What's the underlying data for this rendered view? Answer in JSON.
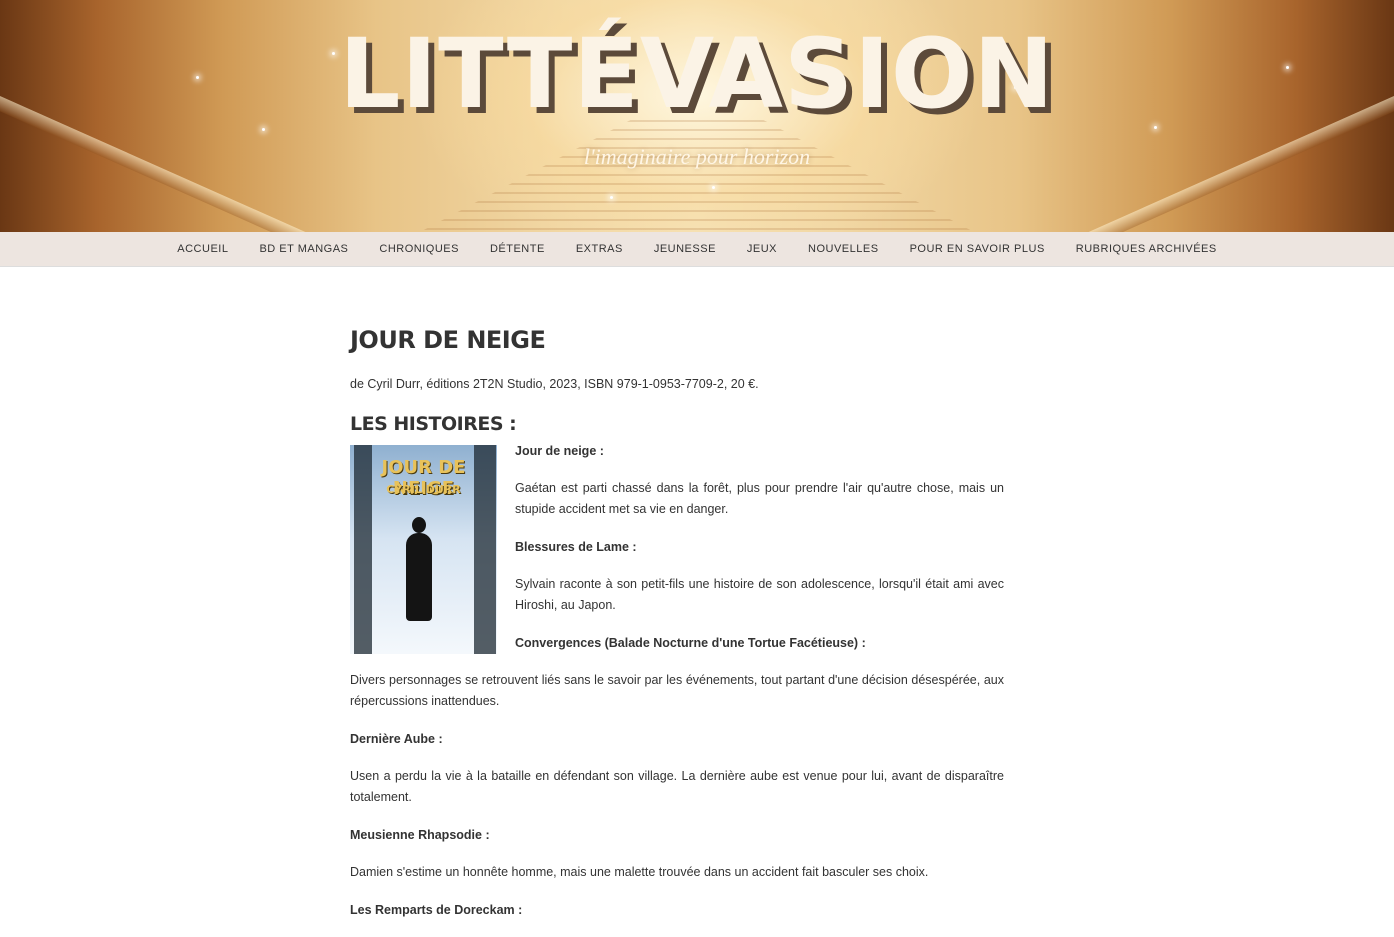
{
  "header": {
    "site_title": "LITTÉVASION",
    "tagline": "l'imaginaire pour horizon"
  },
  "nav": {
    "items": [
      {
        "label": "ACCUEIL"
      },
      {
        "label": "BD ET MANGAS"
      },
      {
        "label": "CHRONIQUES"
      },
      {
        "label": "DÉTENTE"
      },
      {
        "label": "EXTRAS"
      },
      {
        "label": "JEUNESSE"
      },
      {
        "label": "JEUX"
      },
      {
        "label": "NOUVELLES"
      },
      {
        "label": "POUR EN SAVOIR PLUS"
      },
      {
        "label": "RUBRIQUES ARCHIVÉES"
      }
    ]
  },
  "article": {
    "title": "JOUR DE NEIGE",
    "meta": "de Cyril Durr, éditions 2T2N Studio, 2023, ISBN 979-1-0953-7709-2, 20 €.",
    "section_heading": "LES HISTOIRES :",
    "cover": {
      "title": "JOUR DE NEIGE",
      "author": "CYRIL DURR"
    },
    "stories": [
      {
        "title": "Jour de neige :",
        "text": "Gaétan est parti chassé dans la forêt, plus pour prendre l'air qu'autre chose, mais un stupide accident met sa vie en danger."
      },
      {
        "title": "Blessures de Lame :",
        "text": "Sylvain raconte à son petit-fils une histoire de son adolescence, lorsqu'il était ami avec Hiroshi, au Japon."
      },
      {
        "title": "Convergences (Balade Nocturne d'une Tortue Facétieuse) :",
        "text": "Divers personnages se retrouvent liés sans le savoir par les événements, tout partant d'une décision désespérée, aux répercussions inattendues."
      },
      {
        "title": "Dernière Aube :",
        "text": "Usen a perdu la vie à la bataille en défendant son village. La dernière aube est venue pour lui, avant de disparaître totalement."
      },
      {
        "title": "Meusienne Rhapsodie :",
        "text": "Damien s'estime un honnête homme, mais une malette trouvée dans un accident fait basculer ses choix."
      },
      {
        "title": "Les Remparts de Doreckam :",
        "text": ""
      }
    ]
  }
}
